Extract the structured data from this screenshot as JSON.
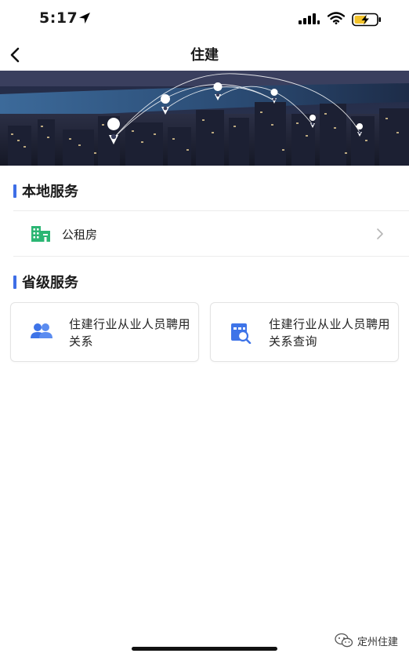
{
  "status_bar": {
    "time": "5:17"
  },
  "nav": {
    "title": "住建"
  },
  "sections": {
    "local": {
      "title": "本地服务",
      "items": [
        {
          "label": "公租房",
          "icon": "building-icon"
        }
      ]
    },
    "provincial": {
      "title": "省级服务",
      "cards": [
        {
          "label": "住建行业从业人员聘用关系",
          "icon": "people-icon"
        },
        {
          "label": "住建行业从业人员聘用关系查询",
          "icon": "search-document-icon"
        }
      ]
    }
  },
  "watermark": {
    "text": "定州住建"
  },
  "colors": {
    "accent": "#3e6ee6",
    "building_icon": "#2bb673",
    "background": "#ffffff"
  }
}
